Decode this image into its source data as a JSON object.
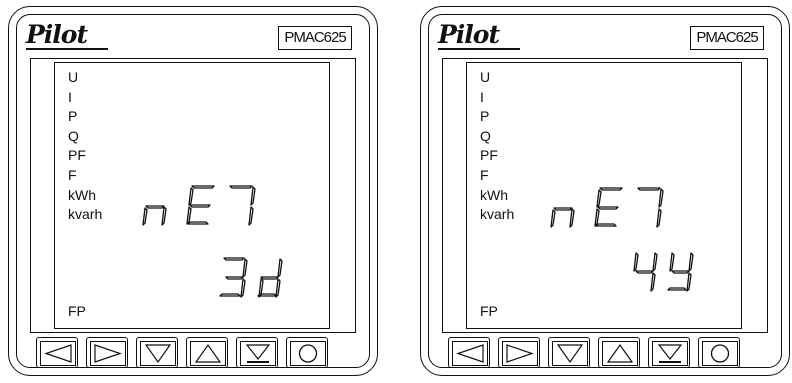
{
  "meters": [
    {
      "brand": "Pilot",
      "model": "PMAC625",
      "parameters": [
        "U",
        "I",
        "P",
        "Q",
        "PF",
        "F",
        "kWh",
        "kvarh"
      ],
      "bottom_label": "FP",
      "display": {
        "line1": "nE7",
        "line2": "3d"
      },
      "buttons": [
        "left-arrow",
        "right-arrow",
        "down-arrow",
        "up-arrow",
        "enter",
        "menu-circle"
      ]
    },
    {
      "brand": "Pilot",
      "model": "PMAC625",
      "parameters": [
        "U",
        "I",
        "P",
        "Q",
        "PF",
        "F",
        "kWh",
        "kvarh"
      ],
      "bottom_label": "FP",
      "display": {
        "line1": "nE7",
        "line2": "4Y"
      },
      "buttons": [
        "left-arrow",
        "right-arrow",
        "down-arrow",
        "up-arrow",
        "enter",
        "menu-circle"
      ]
    }
  ]
}
